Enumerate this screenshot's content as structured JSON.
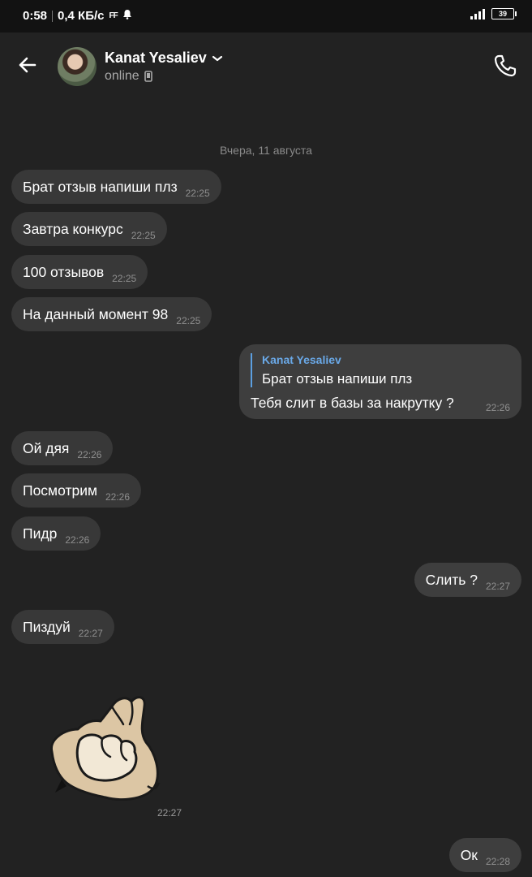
{
  "status_bar": {
    "time": "0:58",
    "speed": "0,4 КБ/с",
    "ff": "FF",
    "battery": "39"
  },
  "header": {
    "contact_name": "Kanat Yesaliev",
    "status": "online"
  },
  "date_separator": "Вчера, 11 августа",
  "messages": [
    {
      "text": "Брат отзыв напиши плз",
      "time": "22:25",
      "direction": "in"
    },
    {
      "text": "Завтра конкурс",
      "time": "22:25",
      "direction": "in"
    },
    {
      "text": "100 отзывов",
      "time": "22:25",
      "direction": "in"
    },
    {
      "text": "На данный момент 98",
      "time": "22:25",
      "direction": "in"
    },
    {
      "reply_author": "Kanat Yesaliev",
      "reply_text": "Брат отзыв напиши плз",
      "text": "Тебя слит в базы за накрутку ?",
      "time": "22:26",
      "direction": "out"
    },
    {
      "text": "Ой дяя",
      "time": "22:26",
      "direction": "in"
    },
    {
      "text": "Посмотрим",
      "time": "22:26",
      "direction": "in"
    },
    {
      "text": "Пидр",
      "time": "22:26",
      "direction": "in"
    },
    {
      "text": "Слить ?",
      "time": "22:27",
      "direction": "out"
    },
    {
      "text": "Пиздуй",
      "time": "22:27",
      "direction": "in"
    },
    {
      "sticker": "fist-sticker",
      "time": "22:27",
      "direction": "in"
    },
    {
      "text": "Ок",
      "time": "22:28",
      "direction": "out"
    }
  ],
  "colors": {
    "background": "#222222",
    "bubble": "#383838",
    "reply_accent": "#5c9fe0"
  }
}
